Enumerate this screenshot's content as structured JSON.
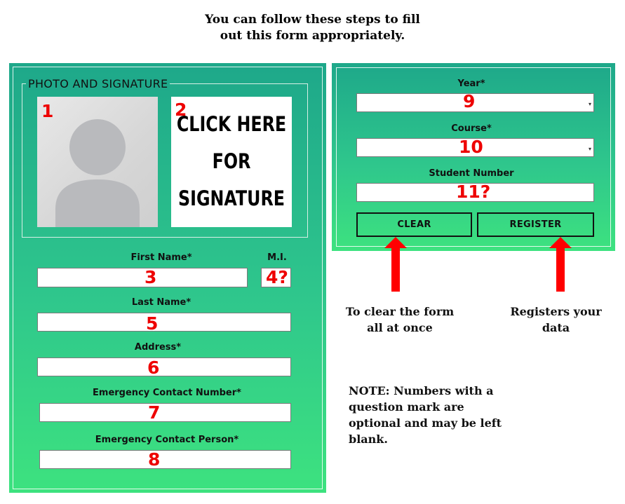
{
  "heading": "You can follow these steps to fill\nout this form appropriately.",
  "photo_section": {
    "legend": "PHOTO AND SIGNATURE",
    "photo_number": "1",
    "signature_number": "2",
    "signature_text": "CLICK HERE\nFOR\nSIGNATURE"
  },
  "left_form": {
    "first_name_label": "First Name*",
    "mi_label": "M.I.",
    "first_name_number": "3",
    "mi_number": "4?",
    "last_name_label": "Last Name*",
    "last_name_number": "5",
    "address_label": "Address*",
    "address_number": "6",
    "emergency_number_label": "Emergency Contact Number*",
    "emergency_number_number": "7",
    "emergency_person_label": "Emergency Contact Person*",
    "emergency_person_number": "8"
  },
  "right_form": {
    "year_label": "Year*",
    "year_number": "9",
    "course_label": "Course*",
    "course_number": "10",
    "student_number_label": "Student Number",
    "student_number_number": "11?",
    "clear_button": "CLEAR",
    "register_button": "REGISTER"
  },
  "annotations": {
    "clear_note": "To clear the form\nall at once",
    "register_note": "Registers your\ndata",
    "note": "NOTE: Numbers with a\nquestion mark are\noptional and may be left\nblank."
  },
  "colors": {
    "panel_top": "#1ea88a",
    "panel_bottom": "#3de27f",
    "number_red": "#ee0000",
    "arrow_red": "#ff0000"
  }
}
